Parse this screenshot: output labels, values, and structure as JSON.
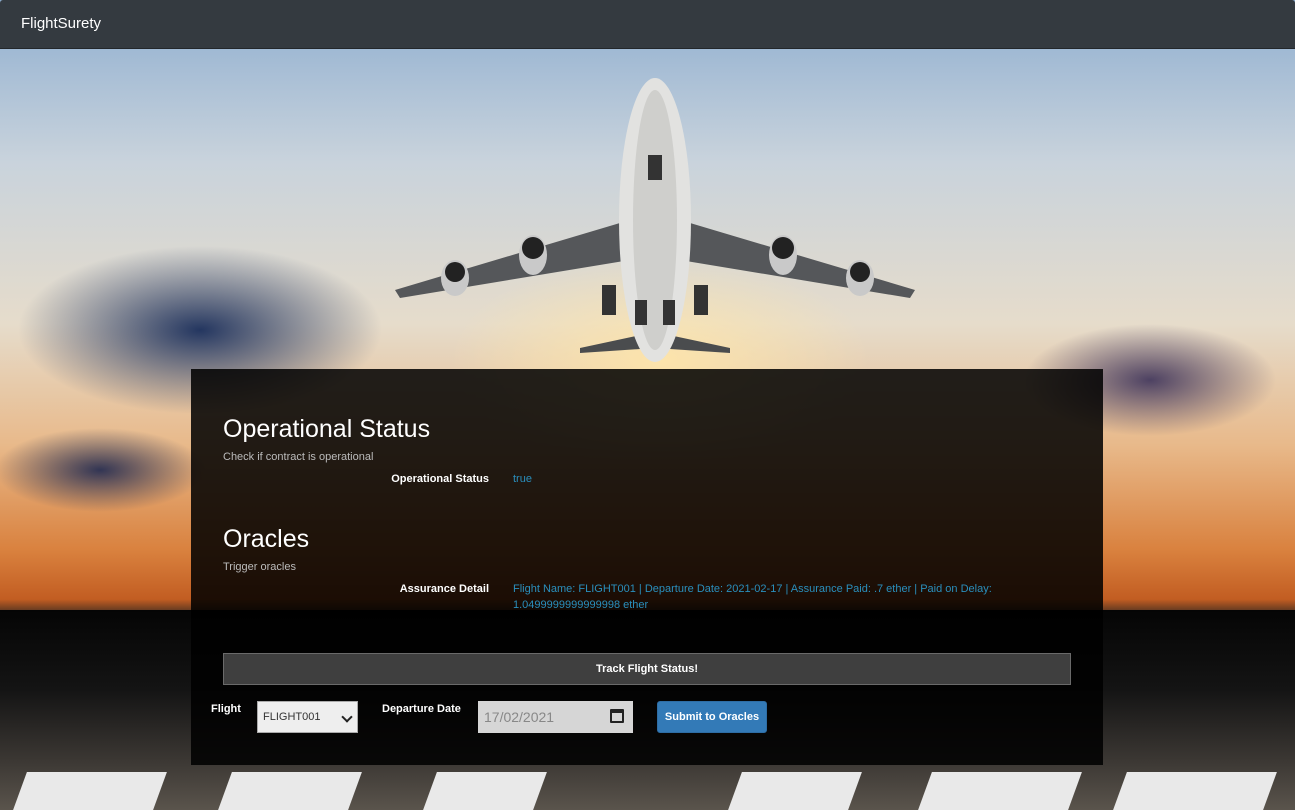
{
  "navbar": {
    "brand": "FlightSurety"
  },
  "operational": {
    "title": "Operational Status",
    "subtitle": "Check if contract is operational",
    "label": "Operational Status",
    "value": "true"
  },
  "oracles": {
    "title": "Oracles",
    "subtitle": "Trigger oracles",
    "label": "Assurance Detail",
    "value_line1": "Flight Name: FLIGHT001 | Departure Date: 2021-02-17 | Assurance Paid: .7 ether | Paid on Delay:",
    "value_line2": "1.0499999999999998 ether"
  },
  "form": {
    "track_button": "Track Flight Status!",
    "flight_label": "Flight",
    "flight_value": "FLIGHT001",
    "date_label": "Departure Date",
    "date_value": "17/02/2021",
    "submit_button": "Submit to Oracles"
  },
  "colors": {
    "navbar": "#343a40",
    "value_text": "#2a8fbd",
    "submit": "#337ab7"
  }
}
